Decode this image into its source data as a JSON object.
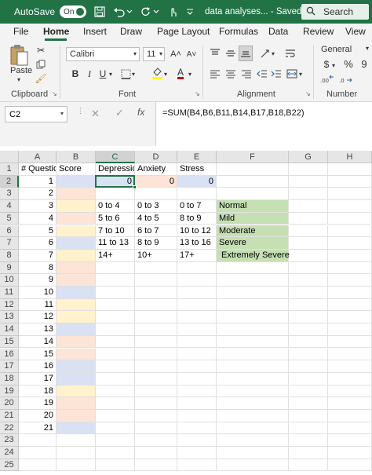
{
  "titlebar": {
    "autosave_label": "AutoSave",
    "toggle_label": "On",
    "doc_title": "data analyses... - Saved",
    "search_label": "Search"
  },
  "menu": {
    "items": [
      "File",
      "Home",
      "Insert",
      "Draw",
      "Page Layout",
      "Formulas",
      "Data",
      "Review",
      "View"
    ],
    "active": "Home"
  },
  "ribbon": {
    "paste_label": "Paste",
    "clipboard_label": "Clipboard",
    "font_label": "Font",
    "alignment_label": "Alignment",
    "number_label": "Number",
    "font_name": "Calibri",
    "font_size": "11",
    "number_format": "General",
    "bold": "B",
    "italic": "I",
    "underline": "U",
    "grow_font": "A˄",
    "shrink_font": "A˅",
    "font_color": "A",
    "font_color_hex": "#c00000",
    "currency": "$",
    "percent": "%",
    "comma": "9"
  },
  "formula_bar": {
    "name_box": "C2",
    "fx": "fx",
    "formula": "=SUM(B4,B6,B11,B14,B17,B18,B22)"
  },
  "grid": {
    "columns": [
      "A",
      "B",
      "C",
      "D",
      "E",
      "F",
      "G",
      "H"
    ],
    "selected_column": "C",
    "selected_row": 2,
    "rows": [
      1,
      2,
      3,
      4,
      5,
      6,
      7,
      8,
      9,
      10,
      11,
      12,
      13,
      14,
      15,
      16,
      17,
      18,
      19,
      20,
      21,
      22,
      23,
      24,
      25
    ],
    "headers": {
      "A1": "# Questions",
      "B1": "Score",
      "C1": "Depression",
      "D1": "Anxiety",
      "E1": "Stress"
    },
    "results": {
      "C2": "0",
      "D2": "0",
      "E2": "0"
    },
    "question_numbers": [
      "1",
      "2",
      "3",
      "4",
      "5",
      "6",
      "7",
      "8",
      "9",
      "10",
      "11",
      "12",
      "13",
      "14",
      "15",
      "16",
      "17",
      "18",
      "19",
      "20",
      "21"
    ],
    "depression_ranges": [
      "0 to 4",
      "5 to 6",
      "7 to 10",
      "11 to 13",
      "14+"
    ],
    "anxiety_ranges": [
      "0 to 3",
      "4 to 5",
      "6 to 7",
      "8 to 9",
      "10+"
    ],
    "stress_ranges": [
      "0 to 7",
      "8 to 9",
      "10 to 12",
      "13 to 16",
      "17+"
    ],
    "severity_labels": [
      "Normal",
      "Mild",
      "Moderate",
      "Severe",
      "Extremely Severe"
    ]
  },
  "colors": {
    "brand": "#217346",
    "depression_fill": "#d9e1f2",
    "anxiety_fill": "#fce4d6",
    "stress_fill": "#fff2cc",
    "severity_fill": "#c6e0b4"
  }
}
